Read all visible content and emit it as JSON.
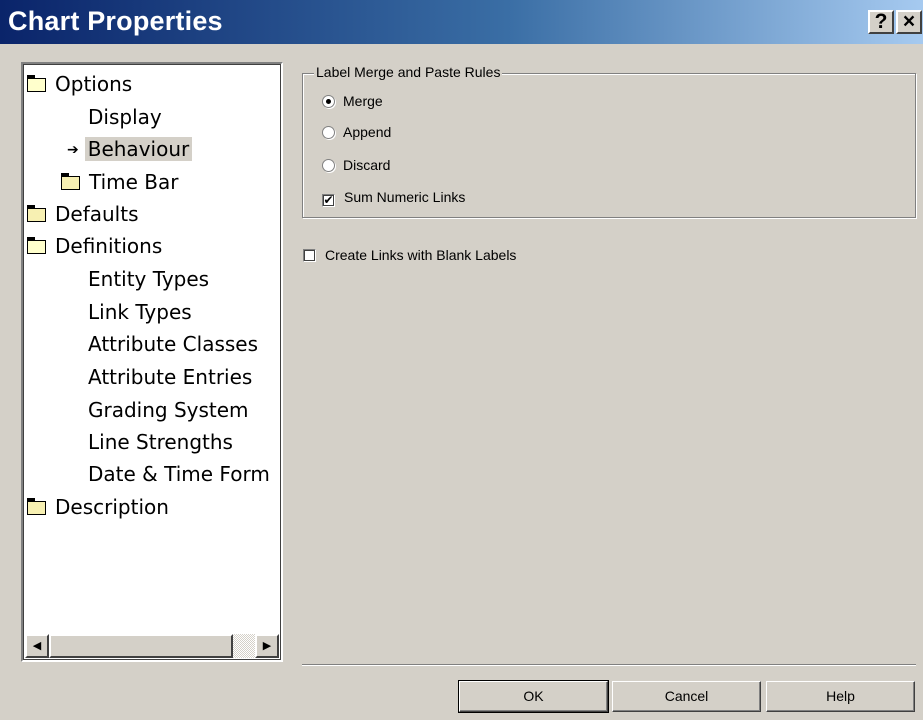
{
  "window": {
    "title": "Chart Properties",
    "help_glyph": "?",
    "close_glyph": "×"
  },
  "tree": {
    "items": [
      {
        "label": "Options",
        "icon": "open-folder-icon"
      },
      {
        "label": "Display"
      },
      {
        "label": "Behaviour",
        "icon": "arrow-icon",
        "selected": true
      },
      {
        "label": "Time Bar",
        "icon": "folder-icon"
      },
      {
        "label": "Defaults",
        "icon": "folder-icon"
      },
      {
        "label": "Definitions",
        "icon": "open-folder-icon"
      },
      {
        "label": "Entity Types"
      },
      {
        "label": "Link Types"
      },
      {
        "label": "Attribute Classes"
      },
      {
        "label": "Attribute Entries"
      },
      {
        "label": "Grading System"
      },
      {
        "label": "Line Strengths"
      },
      {
        "label": "Date & Time Form"
      },
      {
        "label": "Description",
        "icon": "folder-icon"
      }
    ],
    "arrow_glyph": "➔",
    "scroll_left_glyph": "◀",
    "scroll_right_glyph": "▶"
  },
  "label_rules": {
    "legend": "Label Merge and Paste Rules",
    "merge": "Merge",
    "append": "Append",
    "discard": "Discard",
    "selected": "Merge",
    "sum_numeric_links": "Sum Numeric Links",
    "sum_numeric_links_checked": true,
    "check_glyph": "✔"
  },
  "create_blank_labels": {
    "label": "Create Links with Blank Labels",
    "checked": false
  },
  "buttons": {
    "ok": "OK",
    "cancel": "Cancel",
    "help": "Help"
  }
}
